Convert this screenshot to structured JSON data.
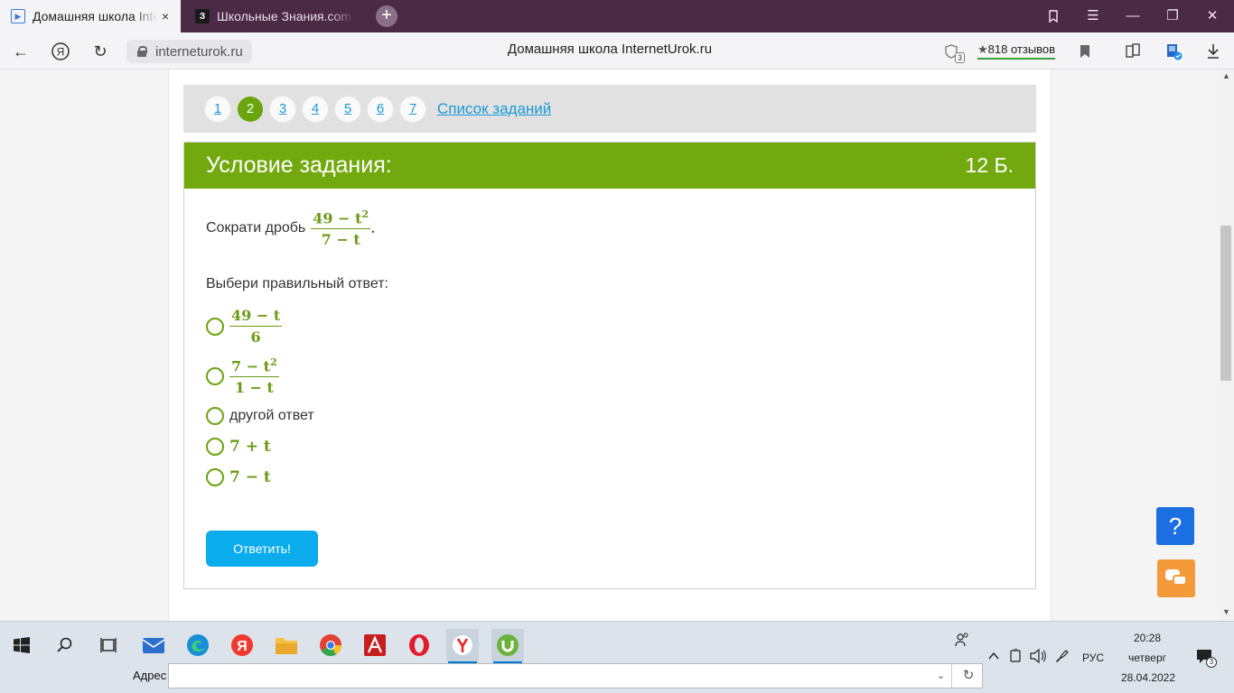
{
  "browser": {
    "tabs": [
      {
        "title": "Домашняя школа InternetUrok.ru",
        "active": true
      },
      {
        "title": "Школьные Знания.com - Решение",
        "active": false
      }
    ],
    "tab_close": "×",
    "new_tab": "+",
    "url": "interneturok.ru",
    "page_title": "Домашняя школа InternetUrok.ru",
    "reviews_label": "818 отзывов",
    "protect_badge": "3",
    "window_controls": {
      "minimize": "—",
      "restore": "❐",
      "close": "✕"
    }
  },
  "pager": {
    "pages": [
      "1",
      "2",
      "3",
      "4",
      "5",
      "6",
      "7"
    ],
    "current": "2",
    "task_list_label": "Список заданий"
  },
  "task": {
    "header_title": "Условие задания:",
    "points": "12 Б.",
    "question_prefix": "Сократи дробь",
    "question_fraction": {
      "numerator": "49 − t",
      "numerator_exp": "2",
      "denominator": "7 − t"
    },
    "choose_label": "Выбери правильный ответ:",
    "options": [
      {
        "type": "fraction",
        "numerator": "49 − t",
        "denominator": "6"
      },
      {
        "type": "fraction",
        "numerator": "7 − t",
        "numerator_exp": "2",
        "denominator": "1 − t"
      },
      {
        "type": "text",
        "text": "другой ответ"
      },
      {
        "type": "math",
        "text": "7 + t"
      },
      {
        "type": "math",
        "text": "7 − t"
      }
    ],
    "submit_label": "Ответить!"
  },
  "widgets": {
    "help_label": "?"
  },
  "taskbar": {
    "address_label": "Адрес",
    "address_value": "",
    "language": "РУС",
    "time": "20:28",
    "day": "четверг",
    "date": "28.04.2022",
    "notification_count": "3"
  },
  "colors": {
    "accent_green": "#72a90e",
    "button_blue": "#0aaceb",
    "link_blue": "#1a9ad6",
    "help_blue": "#1b6fe0",
    "chat_orange": "#f49a3a"
  }
}
